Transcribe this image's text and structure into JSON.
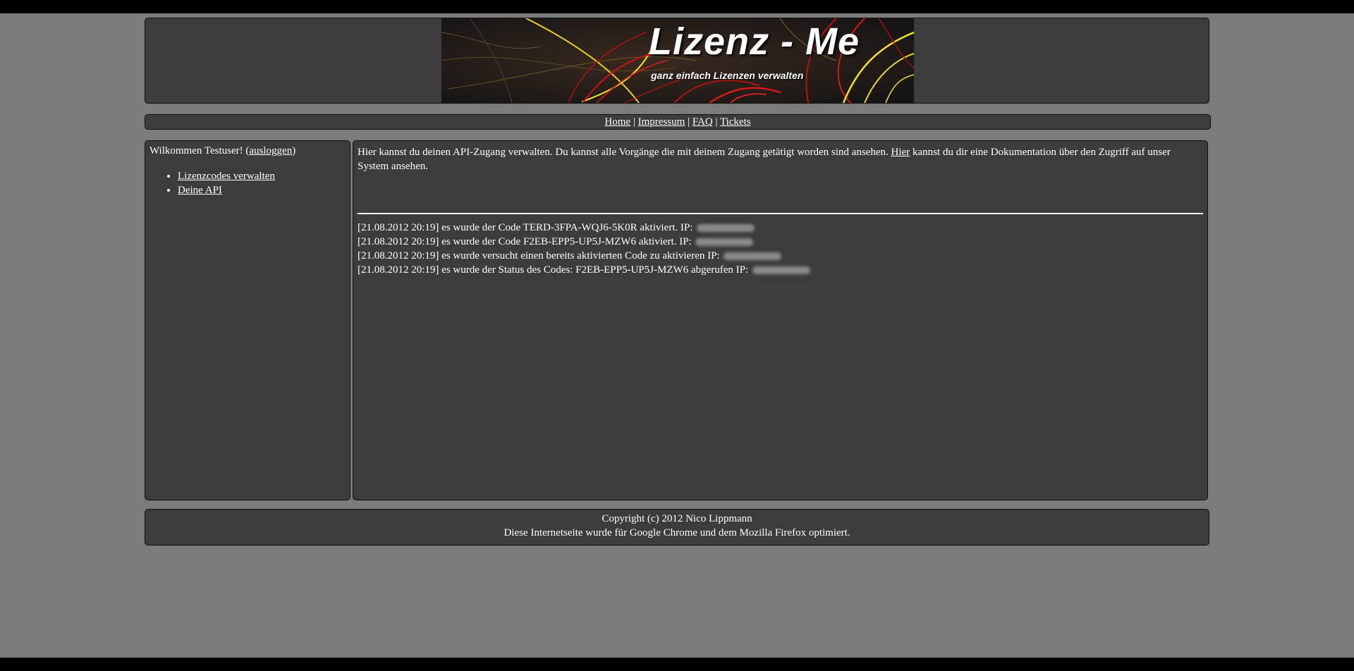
{
  "banner": {
    "title": "Lizenz - Me",
    "subtitle": "ganz einfach Lizenzen verwalten"
  },
  "nav": {
    "items": [
      {
        "label": "Home"
      },
      {
        "label": "Impressum"
      },
      {
        "label": "FAQ"
      },
      {
        "label": "Tickets"
      }
    ],
    "separator": "|"
  },
  "sidebar": {
    "welcome_prefix": "Wilkommen Testuser! (",
    "logout_label": "ausloggen",
    "welcome_suffix": ")",
    "items": [
      {
        "label": "Lizenzcodes verwalten"
      },
      {
        "label": "Deine API"
      }
    ]
  },
  "main": {
    "intro_before_link": "Hier kannst du deinen API-Zugang verwalten. Du kannst alle Vorgänge die mit deinem Zugang getätigt worden sind ansehen. ",
    "intro_link": "Hier",
    "intro_after_link": " kannst du dir eine Dokumentation über den Zugriff auf unser System ansehen.",
    "log": [
      {
        "text": "[21.08.2012 20:19] es wurde der Code TERD-3FPA-WQJ6-5K0R aktiviert. IP:"
      },
      {
        "text": "[21.08.2012 20:19] es wurde der Code F2EB-EPP5-UP5J-MZW6 aktiviert. IP:"
      },
      {
        "text": "[21.08.2012 20:19] es wurde versucht einen bereits aktivierten Code zu aktivieren IP:"
      },
      {
        "text": "[21.08.2012 20:19] es wurde der Status des Codes: F2EB-EPP5-UP5J-MZW6 abgerufen IP:"
      }
    ]
  },
  "footer": {
    "copyright": "Copyright (c) 2012 Nico Lippmann",
    "note": "Diese Internetseite wurde für Google Chrome und dem Mozilla Firefox optimiert."
  },
  "colors": {
    "page_background": "#7b7b7b",
    "panel_background": "#3c3c3c",
    "banner_red": "#d01010",
    "banner_yellow": "#f5e21a"
  }
}
